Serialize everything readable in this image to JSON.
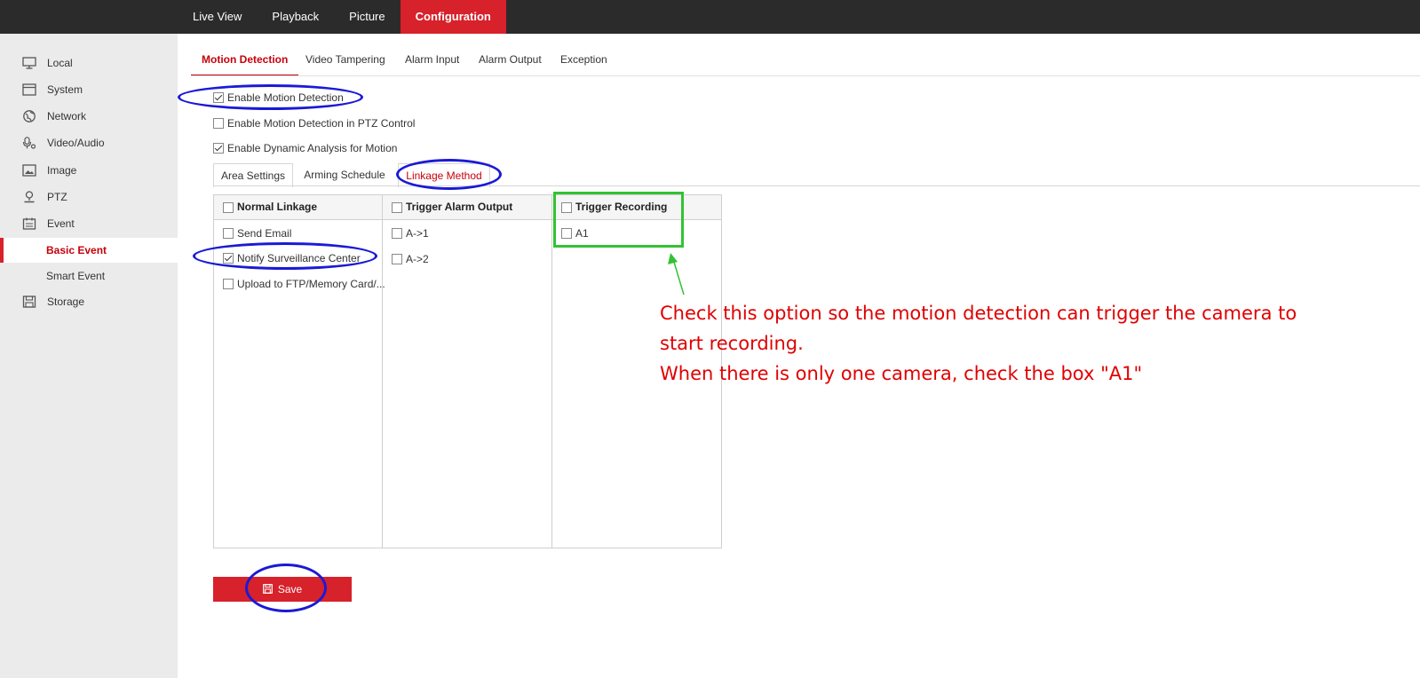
{
  "topnav": {
    "items": [
      "Live View",
      "Playback",
      "Picture",
      "Configuration"
    ],
    "active": "Configuration"
  },
  "sidebar": {
    "items": [
      {
        "label": "Local",
        "icon": "monitor-icon"
      },
      {
        "label": "System",
        "icon": "system-icon"
      },
      {
        "label": "Network",
        "icon": "globe-icon"
      },
      {
        "label": "Video/Audio",
        "icon": "mic-icon"
      },
      {
        "label": "Image",
        "icon": "image-icon"
      },
      {
        "label": "PTZ",
        "icon": "ptz-icon"
      },
      {
        "label": "Event",
        "icon": "calendar-icon"
      }
    ],
    "event_sub": [
      {
        "label": "Basic Event",
        "active": true
      },
      {
        "label": "Smart Event",
        "active": false
      }
    ],
    "storage": {
      "label": "Storage",
      "icon": "save-disk-icon"
    }
  },
  "subtabs": [
    "Motion Detection",
    "Video Tampering",
    "Alarm Input",
    "Alarm Output",
    "Exception"
  ],
  "options": [
    {
      "label": "Enable Motion Detection",
      "checked": true
    },
    {
      "label": "Enable Motion Detection in PTZ Control",
      "checked": false
    },
    {
      "label": "Enable Dynamic Analysis for Motion",
      "checked": true
    }
  ],
  "inner_tabs": [
    "Area Settings",
    "Arming Schedule",
    "Linkage Method"
  ],
  "linkage": {
    "normal": {
      "header": "Normal Linkage",
      "rows": [
        {
          "label": "Send Email",
          "checked": false
        },
        {
          "label": "Notify Surveillance Center",
          "checked": true
        },
        {
          "label": "Upload to FTP/Memory Card/...",
          "checked": false
        }
      ]
    },
    "alarm_output": {
      "header": "Trigger Alarm Output",
      "rows": [
        {
          "label": "A->1",
          "checked": false
        },
        {
          "label": "A->2",
          "checked": false
        }
      ]
    },
    "recording": {
      "header": "Trigger Recording",
      "rows": [
        {
          "label": "A1",
          "checked": false
        }
      ]
    }
  },
  "save_label": "Save",
  "annotation": {
    "line1": "Check this option so the motion detection can trigger the camera to",
    "line2": "start recording.",
    "line3": "When there is only one camera, check the box \"A1\"",
    "oval_color": "#1a1ad6",
    "box_color": "#33c233",
    "text_color": "#e00000"
  }
}
